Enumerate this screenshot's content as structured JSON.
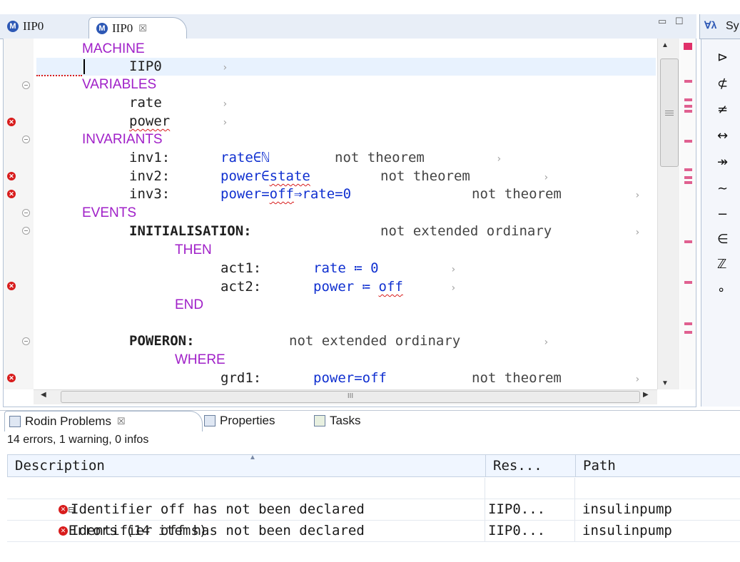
{
  "editor": {
    "tabs": [
      {
        "label": "IIP0",
        "icon": "machine-icon"
      },
      {
        "label": "IIP0",
        "icon": "machine-icon",
        "close": "☒"
      }
    ],
    "code": {
      "l1": "MACHINE",
      "l2": "IIP0",
      "l3": "VARIABLES",
      "l4": "rate",
      "l5": "power",
      "l6": "INVARIANTS",
      "inv1_label": "inv1:",
      "inv1_pred": "rate∈ℕ",
      "inv1_cmt": "not theorem",
      "inv2_label": "inv2:",
      "inv2_pred_a": "power∈",
      "inv2_pred_b": "state",
      "inv2_cmt": "not theorem",
      "inv3_label": "inv3:",
      "inv3_pred_a": "power=",
      "inv3_pred_b": "off",
      "inv3_pred_c": "⇒rate=0",
      "inv3_cmt": "not theorem",
      "events": "EVENTS",
      "init": "INITIALISATION:",
      "init_cmt": "not extended ordinary",
      "then": "THEN",
      "act1_label": "act1:",
      "act1_pred": "rate ≔ 0",
      "act2_label": "act2:",
      "act2_pred_a": "power ≔ ",
      "act2_pred_b": "off",
      "end": "END",
      "poweron": "POWERON:",
      "poweron_cmt": "not extended ordinary",
      "where": "WHERE",
      "grd1_label": "grd1:",
      "grd1_pred": "power=off",
      "grd1_cmt": "not theorem",
      "arrow": "›"
    },
    "hscroll_label": "III"
  },
  "symbols": {
    "tab_label": "Sy",
    "items": [
      "⊳",
      "⊄",
      "≠",
      "↔",
      "↠",
      "∼",
      "−",
      "∈",
      "ℤ",
      "∘"
    ]
  },
  "problems": {
    "tabs": {
      "rodin": "Rodin Problems",
      "close": "☒",
      "properties": "Properties",
      "tasks": "Tasks"
    },
    "summary": "14 errors, 1 warning, 0 infos",
    "columns": {
      "description": "Description",
      "resource": "Res...",
      "path": "Path"
    },
    "group": "Errors (14 items)",
    "rows": [
      {
        "description": "Identifier off has not been declared",
        "resource": "IIP0...",
        "path": "insulinpump"
      },
      {
        "description": "Identifier off has not been declared",
        "resource": "IIP0...",
        "path": "insulinpump"
      }
    ]
  }
}
